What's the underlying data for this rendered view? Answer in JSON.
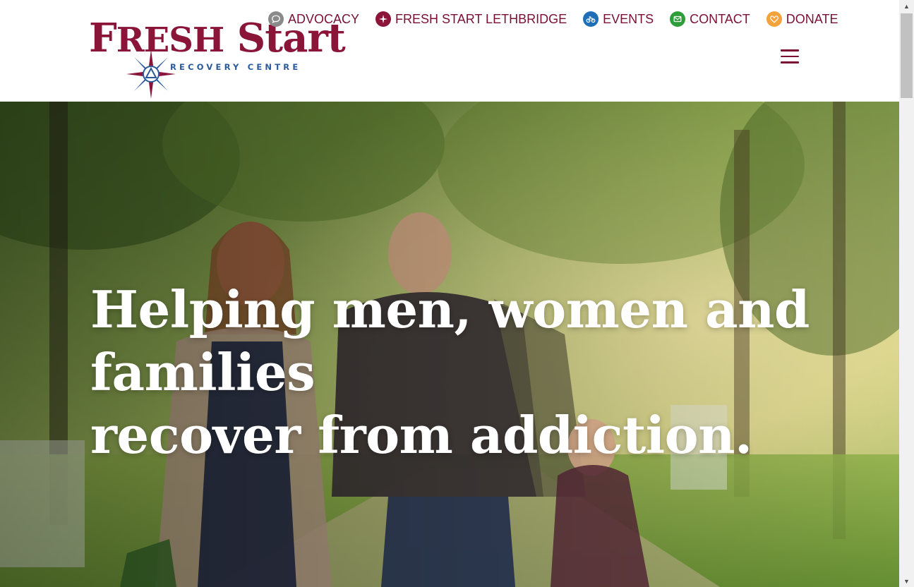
{
  "brand": {
    "title_first": "F",
    "title_rest": "RESH",
    "title_second": "Start",
    "subtitle": "RECOVERY CENTRE",
    "primary_color": "#8a1538",
    "secondary_color": "#2b5a9c"
  },
  "topnav": [
    {
      "label": "ADVOCACY",
      "icon": "chat-bubble-icon",
      "color": "#8a8a8a"
    },
    {
      "label": "FRESH START LETHBRIDGE",
      "icon": "compass-star-icon",
      "color": "#8a1538"
    },
    {
      "label": "EVENTS",
      "icon": "motorcycle-icon",
      "color": "#1e6fb8"
    },
    {
      "label": "CONTACT",
      "icon": "envelope-icon",
      "color": "#2f9e3a"
    },
    {
      "label": "DONATE",
      "icon": "heart-icon",
      "color": "#f2a33a"
    }
  ],
  "menu_icon": "hamburger-menu-icon",
  "hero": {
    "line1": "Helping men, women and",
    "line2": "families",
    "line3": "recover from addiction."
  }
}
